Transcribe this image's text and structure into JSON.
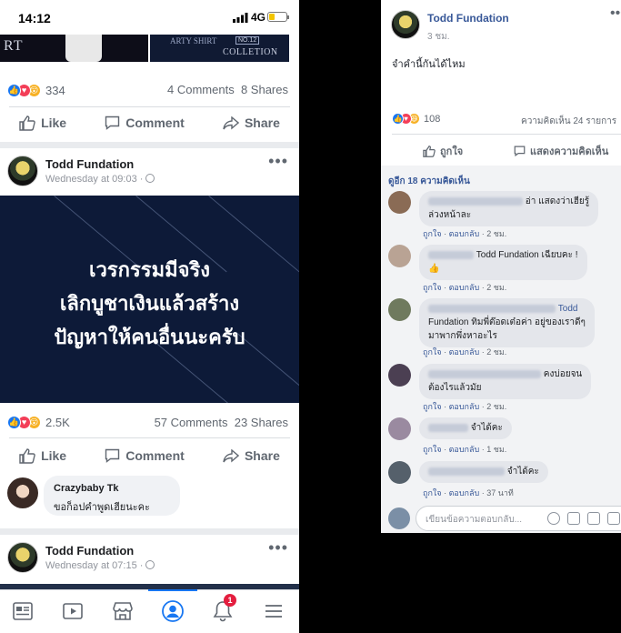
{
  "left": {
    "status_bar": {
      "time": "14:12",
      "network": "4G"
    },
    "post1": {
      "banner_left_text": "RT",
      "banner_right_text": "COLLETION",
      "banner_right_small": "ARTY SHIRT",
      "banner_tag": "NO.12",
      "reactions": "334",
      "comments": "4 Comments",
      "shares": "8 Shares"
    },
    "actions": {
      "like": "Like",
      "comment": "Comment",
      "share": "Share"
    },
    "post2": {
      "author": "Todd Fundation",
      "time": "Wednesday at 09:03 ·",
      "quote_lines": [
        "เวรกรรมมีจริง",
        "เลิกบูชาเงินแล้วสร้าง",
        "ปัญหาให้คนอื่นนะครับ"
      ],
      "reactions": "2.5K",
      "comments": "57 Comments",
      "shares": "23 Shares",
      "comment_preview": {
        "name": "Crazybaby Tk",
        "text": "ขอก็อปคำพูดเฮียนะคะ"
      }
    },
    "post3": {
      "author": "Todd Fundation",
      "time": "Wednesday at 07:15 ·"
    },
    "tabbar": {
      "notification_badge": "1"
    }
  },
  "right": {
    "author": "Todd Fundation",
    "time": "3 ชม.",
    "text": "จำคำนี้กันได้ไหม",
    "reactions": "108",
    "comment_count": "ความคิดเห็น 24 รายการ",
    "actions": {
      "like": "ถูกใจ",
      "comment": "แสดงความคิดเห็น"
    },
    "more_comments": "ดูอีก 18 ความคิดเห็น",
    "comments": [
      {
        "line1": "อ่า แสดงว่าเฮียรู้",
        "line2": "ล่วงหน้าละ",
        "meta_like": "ถูกใจ",
        "meta_reply": "ตอบกลับ",
        "meta_time": "2 ชม."
      },
      {
        "line1": "Todd Fundation เฉียบคะ !",
        "line2": "👍",
        "meta_like": "ถูกใจ",
        "meta_reply": "ตอบกลับ",
        "meta_time": "2 ชม."
      },
      {
        "name_tail": "Todd",
        "line2": "Fundation ทิมพี่ต๊อดเต๋อค่า อยู่ของเราดีๆ",
        "line3": "มาพากพึ่งหาอะไร",
        "meta_like": "ถูกใจ",
        "meta_reply": "ตอบกลับ",
        "meta_time": "2 ชม."
      },
      {
        "line1": "คงบ่อยจน",
        "line2": "ต้องไรแล้วมัย",
        "meta_like": "ถูกใจ",
        "meta_reply": "ตอบกลับ",
        "meta_time": "2 ชม."
      },
      {
        "line1": "จำได้คะ",
        "meta_like": "ถูกใจ",
        "meta_reply": "ตอบกลับ",
        "meta_time": "1 ชม."
      },
      {
        "line1": "จำได้คะ",
        "meta_like": "ถูกใจ",
        "meta_reply": "ตอบกลับ",
        "meta_time": "37 นาที"
      }
    ],
    "input_placeholder": "เขียนข้อความตอบกลับ..."
  }
}
